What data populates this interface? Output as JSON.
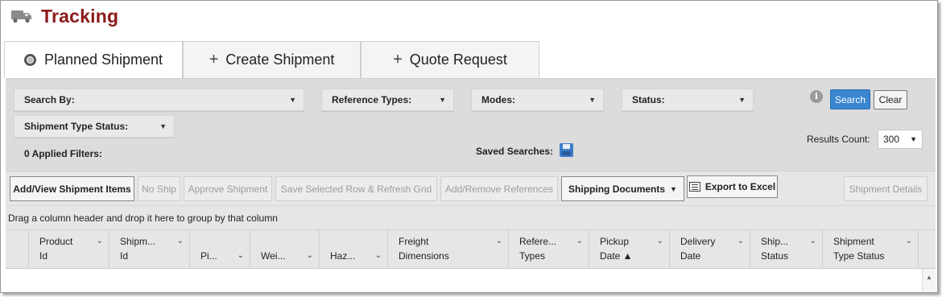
{
  "header": {
    "title": "Tracking",
    "icon": "truck-icon"
  },
  "tabs": [
    {
      "label": "Planned Shipment",
      "icon": "radio-icon",
      "active": true
    },
    {
      "label": "Create Shipment",
      "icon": "+"
    },
    {
      "label": "Quote Request",
      "icon": "+"
    }
  ],
  "filters": {
    "search_by": "Search By:",
    "reference_types": "Reference Types:",
    "modes": "Modes:",
    "status": "Status:",
    "shipment_type_status": "Shipment Type Status:",
    "applied_filters": "0 Applied Filters:",
    "saved_searches": "Saved Searches:",
    "results_count_label": "Results Count:",
    "results_count_value": "300",
    "search_button": "Search",
    "clear_button": "Clear",
    "info_glyph": "i",
    "caret": "▼"
  },
  "toolbar": {
    "add_view": "Add/View Shipment Items",
    "no_ship": "No Ship",
    "approve": "Approve Shipment",
    "save_refresh": "Save Selected Row & Refresh Grid",
    "add_remove_refs": "Add/Remove References",
    "shipping_docs": "Shipping Documents",
    "export_excel": "Export to Excel",
    "shipment_details": "Shipment Details"
  },
  "group_hint": "Drag a column header and drop it here to group by that column",
  "columns": [
    {
      "line1": "Product",
      "line2": "Id"
    },
    {
      "line1": "Shipm...",
      "line2": "Id"
    },
    {
      "line1": "",
      "line2": "Pi..."
    },
    {
      "line1": "",
      "line2": "Wei..."
    },
    {
      "line1": "",
      "line2": "Haz..."
    },
    {
      "line1": "Freight",
      "line2": "Dimensions"
    },
    {
      "line1": "Refere...",
      "line2": "Types"
    },
    {
      "line1": "Pickup",
      "line2": "Date ▲"
    },
    {
      "line1": "Delivery",
      "line2": "Date"
    },
    {
      "line1": "Ship...",
      "line2": "Status"
    },
    {
      "line1": "Shipment",
      "line2": "Type Status"
    }
  ],
  "glyphs": {
    "chevron": "⌄",
    "scroll_up": "▲"
  },
  "colors": {
    "title": "#8b1a1a",
    "search_button": "#3b86d1"
  }
}
